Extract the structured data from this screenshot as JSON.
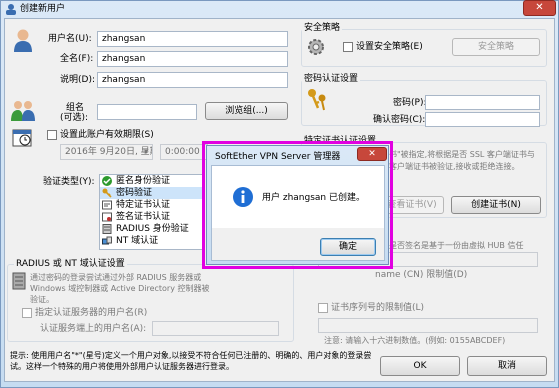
{
  "window": {
    "title": "创建新用户"
  },
  "form": {
    "username_label": "用户名(U):",
    "username_value": "zhangsan",
    "fullname_label": "全名(F):",
    "fullname_value": "zhangsan",
    "note_label": "说明(D):",
    "note_value": "zhangsan",
    "group_label_1": "组名",
    "group_label_2": "(可选):",
    "group_value": "",
    "browse_label": "浏览组(...)",
    "expire_label": "设置此账户有效期限(S)",
    "date_value": "2016年 9月20日, 星期",
    "time_value": "0:00:00",
    "auth_label": "验证类型(Y):"
  },
  "auth_list": [
    "匿名身份验证",
    "密码验证",
    "特定证书认证",
    "签名证书认证",
    "RADIUS 身份验证",
    "NT 域认证"
  ],
  "radius": {
    "title": "RADIUS 或 NT 域认证设置",
    "desc": "通过密码的登录尝试通过外部 RADIUS 服务器或 Windows 域控制器或 Active Directory 控制器被验证。",
    "specify_label": "指定认证服务器的用户名(R)",
    "server_user_label": "认证服务端上的用户名(A):"
  },
  "security": {
    "title": "安全策略",
    "checkbox_label": "设置安全策略(E)",
    "button_label": "安全策略"
  },
  "password": {
    "title": "密码认证设置",
    "pw_label": "密码(P):",
    "confirm_label": "确认密码(C):"
  },
  "cert": {
    "title": "特定证书认证设置",
    "desc_fragment": "证书\"被指定,...",
    "desc": "书\"被指定,将根据是否 SSL 客户端证书与",
    "desc2": "客户端证书被验证,接收或拒绝连接。",
    "view_button": "查看证书(V)",
    "create_button": "创建证书(N)",
    "sign_desc": "是否签名是基于一份由虚拟 HUB 信任",
    "cn_label": "name (CN) 限制值(D)",
    "serial_label": "证书序列号的限制值(L)",
    "note": "注意: 请输入十六进制数值。(例如: 0155ABCDEF)"
  },
  "hint": "提示: 使用用户名\"*\"(星号)定义一个用户对象,以接受不符合任何已注册的、明确的、用户对象的登录尝试。这样一个特殊的用户将使用外部用户认证服务器进行登录。",
  "ok_label": "OK",
  "cancel_label": "取消",
  "dialog": {
    "title": "SoftEther VPN Server 管理器",
    "message": "用户 zhangsan 已创建。",
    "ok_label": "确定"
  },
  "colors": {
    "highlight": "#e100e1",
    "info_icon": "#1f6ed4",
    "selected": "#3399ff"
  }
}
